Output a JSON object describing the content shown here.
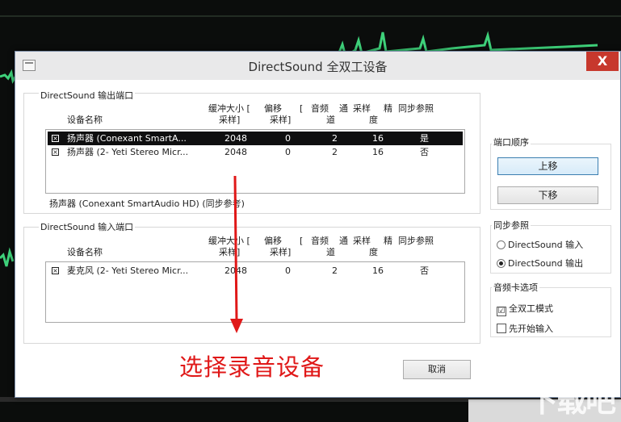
{
  "window": {
    "title": "DirectSound 全双工设备",
    "close_label": "X"
  },
  "output_group": {
    "label": "DirectSound 输出端口",
    "columns": {
      "device": "设备名称",
      "buffer_line1": "缓冲大小 [",
      "buffer_line2": "采样]",
      "offset_line1": "偏移",
      "offset_line2": "采样]",
      "offset_bracket": "[",
      "channels_line1": "音频",
      "channels_line1b": "通",
      "channels_line2": "道",
      "bits_line1": "采样",
      "bits_line1b": "精",
      "bits_line2": "度",
      "sync": "同步参照"
    },
    "rows": [
      {
        "checked": "☒",
        "device": "扬声器 (Conexant SmartA...",
        "buffer": "2048",
        "offset": "0",
        "channels": "2",
        "bits": "16",
        "sync": "是"
      },
      {
        "checked": "☒",
        "device": "扬声器 (2- Yeti Stereo Micr...",
        "buffer": "2048",
        "offset": "0",
        "channels": "2",
        "bits": "16",
        "sync": "否"
      }
    ],
    "sync_reference": "扬声器 (Conexant SmartAudio HD) (同步参考)"
  },
  "input_group": {
    "label": "DirectSound 输入端口",
    "columns": {
      "device": "设备名称",
      "buffer_line1": "缓冲大小 [",
      "buffer_line2": "采样]",
      "offset_line1": "偏移",
      "offset_line2": "采样]",
      "offset_bracket": "[",
      "channels_line1": "音频",
      "channels_line1b": "通",
      "channels_line2": "道",
      "bits_line1": "采样",
      "bits_line1b": "精",
      "bits_line2": "度",
      "sync": "同步参照"
    },
    "rows": [
      {
        "checked": "☒",
        "device": "麦克风 (2- Yeti Stereo Micr...",
        "buffer": "2048",
        "offset": "0",
        "channels": "2",
        "bits": "16",
        "sync": "否"
      }
    ]
  },
  "port_order": {
    "label": "端口顺序",
    "up": "上移",
    "down": "下移"
  },
  "sync_ref": {
    "label": "同步参照",
    "options": [
      "DirectSound 输入",
      "DirectSound 输出"
    ],
    "selected": "DirectSound 输出"
  },
  "sound_card": {
    "label": "音频卡选项",
    "full_duplex": "全双工模式",
    "full_duplex_checked": "☑",
    "start_input_first": "先开始输入"
  },
  "cancel_label": "取消",
  "annotation": "选择录音设备",
  "watermark": "下载吧",
  "colors": {
    "annotation": "#e01818",
    "close": "#c7382d",
    "selection": "#0f0f10"
  }
}
